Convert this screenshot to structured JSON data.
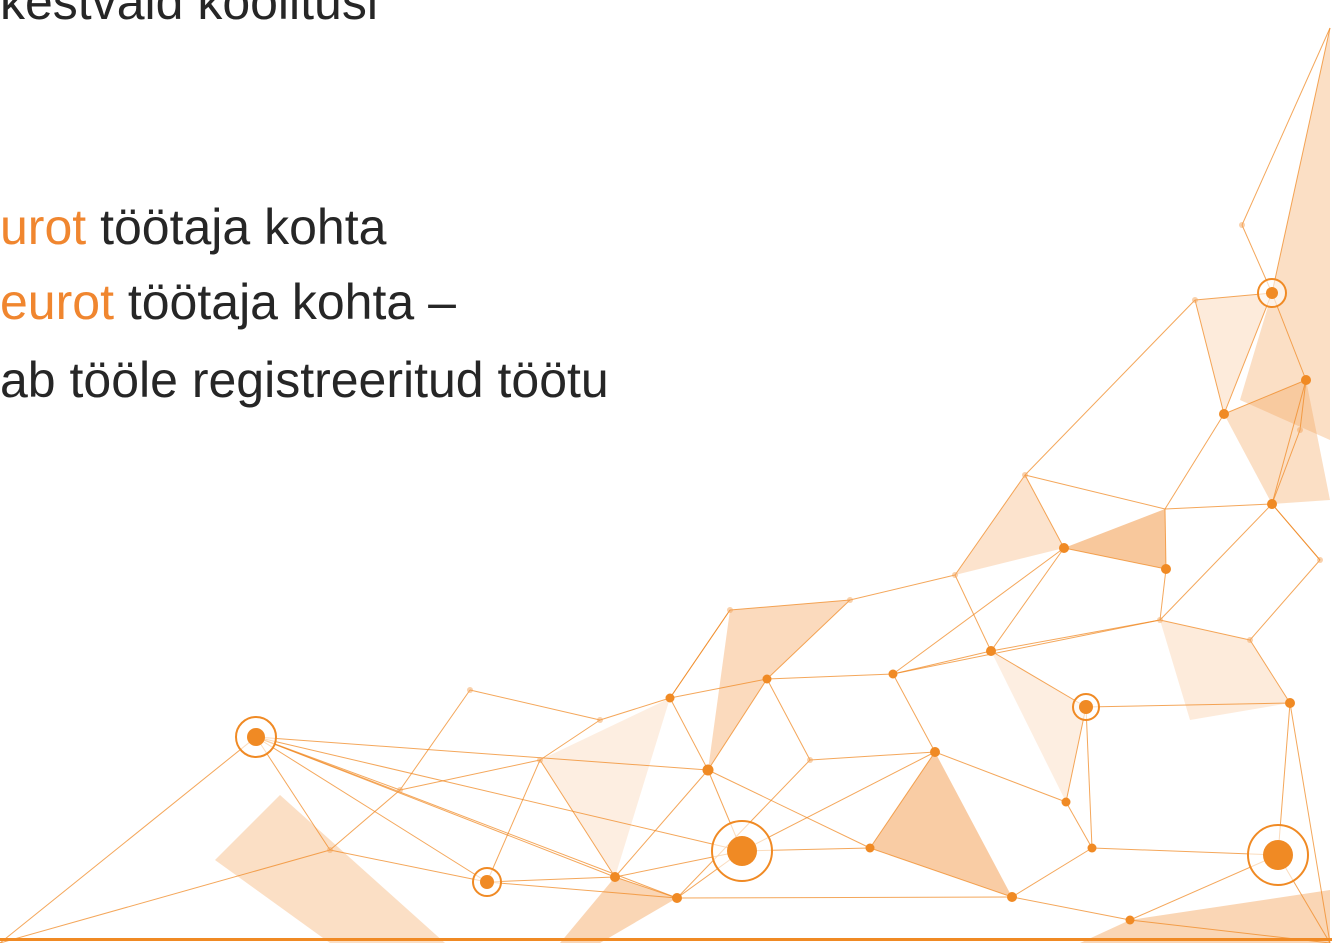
{
  "slide": {
    "lines": [
      {
        "parts": [
          {
            "text": "kestvaid koolitusi",
            "accent": false
          }
        ]
      },
      {
        "parts": [
          {
            "text": "urot",
            "accent": true
          },
          {
            "text": " töötaja kohta",
            "accent": false
          }
        ]
      },
      {
        "parts": [
          {
            "text": "eurot",
            "accent": true
          },
          {
            "text": " töötaja kohta –",
            "accent": false
          }
        ]
      },
      {
        "parts": [
          {
            "text": "ab tööle registreeritud töötu",
            "accent": false
          }
        ]
      }
    ]
  },
  "colors": {
    "text": "#262626",
    "accent": "#f0862f",
    "network_line": "#f08a24",
    "network_fill": "#f4a35a",
    "rule": "#f08a24"
  }
}
